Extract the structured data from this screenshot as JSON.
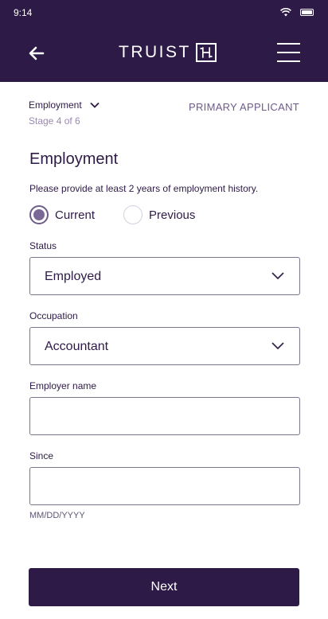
{
  "status_bar": {
    "time": "9:14",
    "icons": [
      "wifi-icon",
      "battery-icon"
    ]
  },
  "header": {
    "brand": "TRUIST",
    "back_icon": "arrow-left-icon",
    "menu_icon": "hamburger-menu-icon"
  },
  "stage": {
    "current": "Employment",
    "progress": "Stage 4 of 6",
    "applicant": "PRIMARY APPLICANT"
  },
  "form": {
    "title": "Employment",
    "helper": "Please provide at least 2 years of employment history.",
    "radios": [
      {
        "label": "Current",
        "selected": true
      },
      {
        "label": "Previous",
        "selected": false
      }
    ],
    "status": {
      "label": "Status",
      "value": "Employed"
    },
    "occupation": {
      "label": "Occupation",
      "value": "Accountant"
    },
    "employer": {
      "label": "Employer name",
      "value": ""
    },
    "since": {
      "label": "Since",
      "value": "",
      "hint": "MM/DD/YYYY"
    }
  },
  "actions": {
    "next": "Next"
  },
  "colors": {
    "brand": "#2e1a47",
    "accent": "#7a6896",
    "muted": "#9a88b3"
  }
}
